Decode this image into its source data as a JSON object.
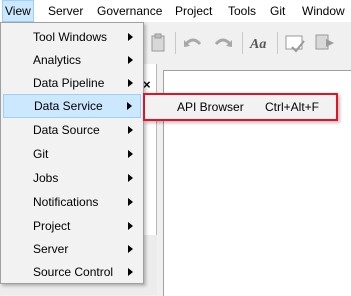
{
  "menubar": {
    "items": [
      "View",
      "Server",
      "Governance",
      "Project",
      "Tools",
      "Git",
      "Window"
    ],
    "active": "View"
  },
  "view_menu": {
    "items": [
      {
        "label": "Tool Windows",
        "submenu": true
      },
      {
        "label": "Analytics",
        "submenu": true
      },
      {
        "label": "Data Pipeline",
        "submenu": true
      },
      {
        "label": "Data Service",
        "submenu": true,
        "selected": true
      },
      {
        "label": "Data Source",
        "submenu": true
      },
      {
        "label": "Git",
        "submenu": true
      },
      {
        "label": "Jobs",
        "submenu": true
      },
      {
        "label": "Notifications",
        "submenu": true
      },
      {
        "label": "Project",
        "submenu": true
      },
      {
        "label": "Server",
        "submenu": true
      },
      {
        "label": "Source Control",
        "submenu": true
      }
    ]
  },
  "submenu": {
    "items": [
      {
        "label": "API Browser",
        "shortcut": "Ctrl+Alt+F"
      }
    ],
    "highlight_color": "#e81123"
  },
  "toolbar": {
    "icons": [
      "paste-icon",
      "undo-icon",
      "redo-icon",
      "font-icon",
      "validate-icon",
      "export-icon"
    ]
  },
  "panel": {
    "close_glyph": "×"
  },
  "colors": {
    "menu_bg": "#f2f2f2",
    "selected_bg": "#cce8ff",
    "selected_border": "#99d1ff",
    "annotation": "#e81123"
  }
}
